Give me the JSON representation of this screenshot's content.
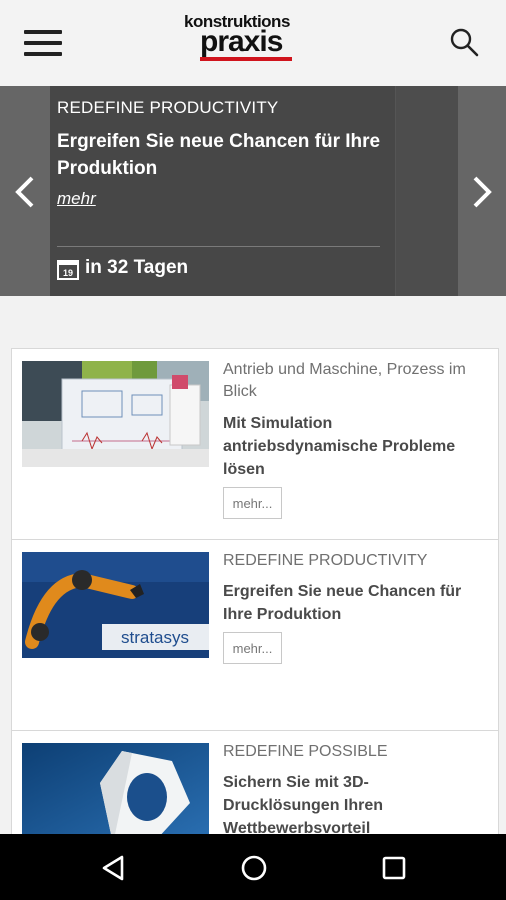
{
  "header": {
    "logo_line1": "konstruktions",
    "logo_line2": "praxis",
    "icons": {
      "menu": "hamburger-menu-icon",
      "search": "search-icon"
    }
  },
  "carousel": {
    "kicker": "REDEFINE PRODUCTIVITY",
    "headline": "Ergreifen Sie neue Chancen für Ihre Produktion",
    "more": "mehr",
    "calendar_day": "19",
    "days_text": "in 32 Tagen"
  },
  "articles": [
    {
      "category": "Antrieb und Maschine, Prozess im Blick",
      "title": "Mit Simulation antriebsdynamische Probleme lösen",
      "more": "mehr..."
    },
    {
      "category": "REDEFINE PRODUCTIVITY",
      "title": "Ergreifen Sie neue Chancen für Ihre Produktion",
      "more": "mehr...",
      "image_brand": "stratasys"
    },
    {
      "category": "REDEFINE POSSIBLE",
      "title": "Sichern Sie mit 3D-Drucklösungen Ihren Wettbewerbsvorteil"
    }
  ],
  "colors": {
    "brand_red": "#d0141d",
    "carousel_bg": "#474747"
  }
}
